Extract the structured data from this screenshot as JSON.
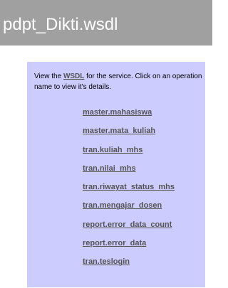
{
  "page": {
    "title": "pdpt_Dikti.wsdl"
  },
  "intro": {
    "before_link": "View the ",
    "link_label": "WSDL",
    "after_link": " for the service. Click on an operation name to view it's details."
  },
  "operations": [
    {
      "label": "master.mahasiswa"
    },
    {
      "label": "master.mata_kuliah"
    },
    {
      "label": "tran.kuliah_mhs"
    },
    {
      "label": "tran.nilai_mhs"
    },
    {
      "label": "tran.riwayat_status_mhs"
    },
    {
      "label": "tran.mengajar_dosen"
    },
    {
      "label": "report.error_data_count"
    },
    {
      "label": "report.error_data"
    },
    {
      "label": "tran.teslogin"
    }
  ],
  "colors": {
    "title_bar": "#a0a0a0",
    "panel": "#ccccff",
    "link": "#555555"
  }
}
